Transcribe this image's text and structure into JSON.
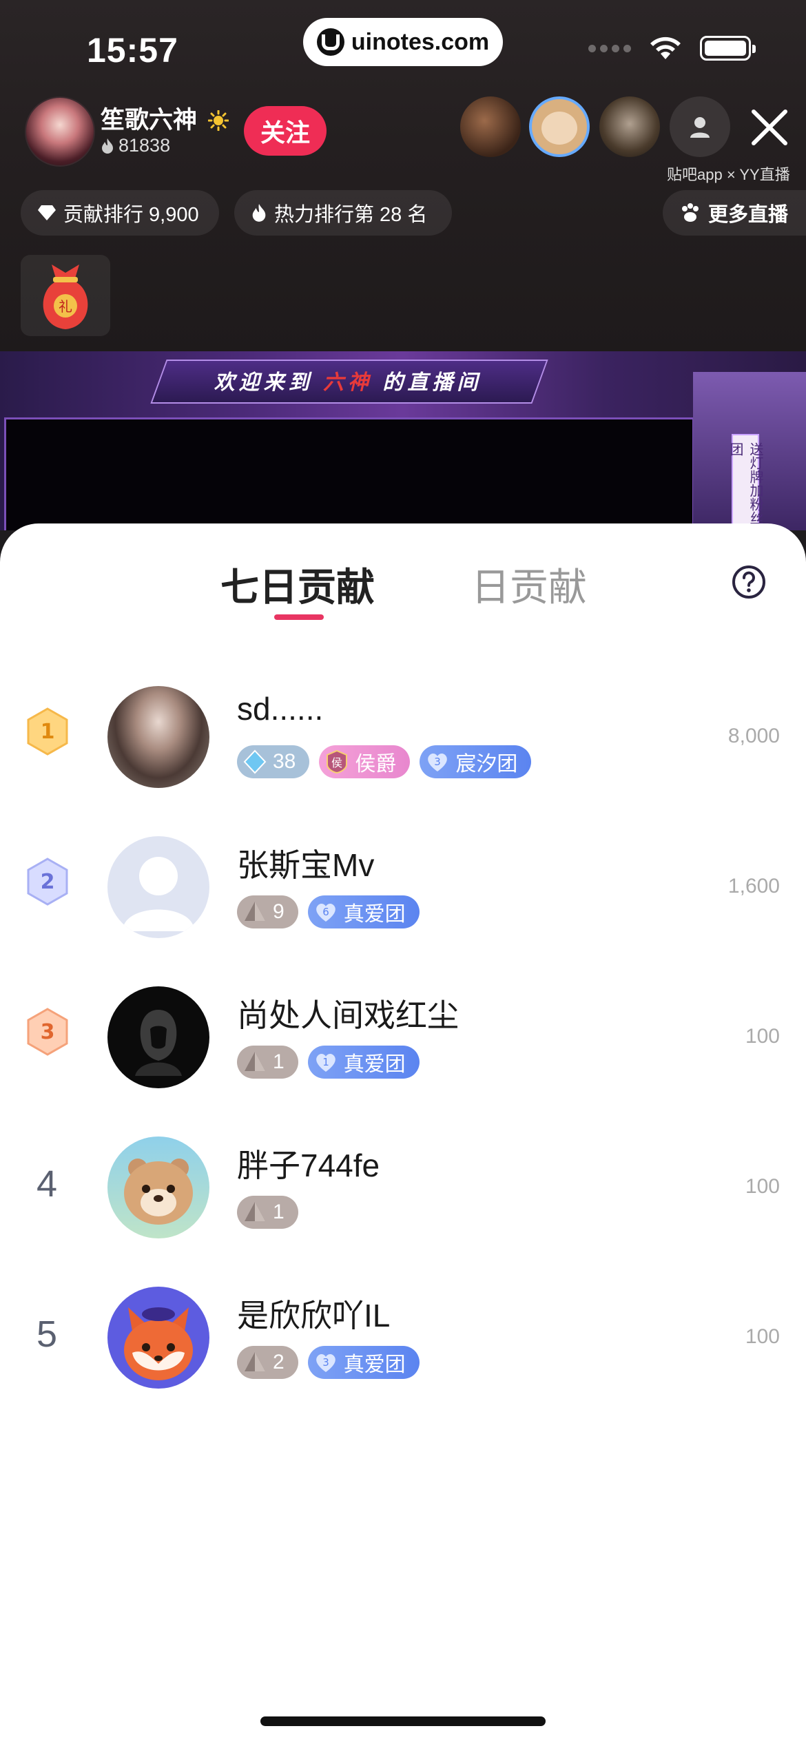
{
  "status_bar": {
    "time": "15:57",
    "url": "uinotes.com"
  },
  "host": {
    "name": "笙歌六神",
    "fans": "81838",
    "follow_label": "关注"
  },
  "partner_text": "贴吧app × YY直播",
  "chips": {
    "contribution_rank": "贡献排行 9,900",
    "heat_rank": "热力排行第 28 名",
    "more_live": "更多直播"
  },
  "stream": {
    "welcome_prefix": "欢迎来到",
    "welcome_name": "六神",
    "welcome_suffix": "的直播间",
    "side_sign": "送灯牌加粉丝团"
  },
  "tabs": {
    "seven_day": "七日贡献",
    "daily": "日贡献"
  },
  "ranking": [
    {
      "rank": "1",
      "name": "sd......",
      "score": "8,000",
      "badges": [
        {
          "type": "gem",
          "text": "38"
        },
        {
          "type": "noble",
          "text": "侯爵"
        },
        {
          "type": "fan",
          "level": "3",
          "text": "宸汐团"
        }
      ]
    },
    {
      "rank": "2",
      "name": "张斯宝Mv",
      "score": "1,600",
      "badges": [
        {
          "type": "tri",
          "text": "9"
        },
        {
          "type": "fan",
          "level": "6",
          "text": "真爱团"
        }
      ]
    },
    {
      "rank": "3",
      "name": "尚处人间戏红尘",
      "score": "100",
      "badges": [
        {
          "type": "tri",
          "text": "1"
        },
        {
          "type": "fan",
          "level": "1",
          "text": "真爱团"
        }
      ]
    },
    {
      "rank": "4",
      "name": "胖子744fe",
      "score": "100",
      "badges": [
        {
          "type": "tri",
          "text": "1"
        }
      ]
    },
    {
      "rank": "5",
      "name": "是欣欣吖IL",
      "score": "100",
      "badges": [
        {
          "type": "tri",
          "text": "2"
        },
        {
          "type": "fan",
          "level": "3",
          "text": "真爱团"
        }
      ]
    }
  ],
  "colors": {
    "accent": "#e83562",
    "follow_bg": "#ef2d55",
    "fan_badge": "#6b90f2"
  }
}
